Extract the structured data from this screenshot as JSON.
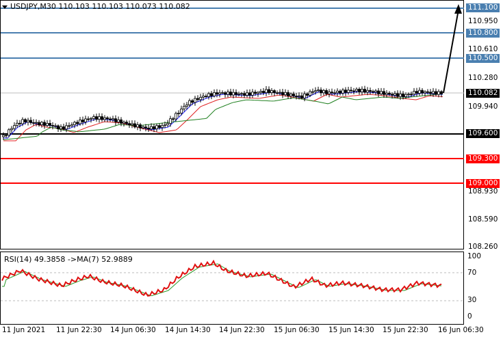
{
  "header": {
    "symbol_info": "USDJPY,M30  110.103 110.103 110.073 110.082",
    "rsi_info": "RSI(14) 49.3858  ->MA(7) 52.9889"
  },
  "colors": {
    "blue_line": "#4a7fb0",
    "black_line": "#000000",
    "red_line": "#ff0000",
    "ma_fast": "#1a1aff",
    "ma_mid": "#e02020",
    "ma_slow": "#208020",
    "rsi_line": "#e01010",
    "rsi_ma": "#2a9a2a"
  },
  "price_axis": [
    "110.950",
    "110.610",
    "110.280",
    "109.940",
    "108.930",
    "108.590",
    "108.260"
  ],
  "levels": [
    {
      "label": "111.100",
      "color": "#4a7fb0",
      "kind": "blue"
    },
    {
      "label": "110.800",
      "color": "#4a7fb0",
      "kind": "blue"
    },
    {
      "label": "110.500",
      "color": "#4a7fb0",
      "kind": "blue"
    },
    {
      "label": "110.082",
      "color": "#000000",
      "kind": "current"
    },
    {
      "label": "109.600",
      "color": "#000000",
      "kind": "black"
    },
    {
      "label": "109.300",
      "color": "#ff0000",
      "kind": "red"
    },
    {
      "label": "109.000",
      "color": "#ff0000",
      "kind": "red"
    }
  ],
  "rsi_axis": [
    "100",
    "70",
    "30",
    "0"
  ],
  "time_axis": [
    "11 Jun 2021",
    "11 Jun 22:30",
    "14 Jun 06:30",
    "14 Jun 14:30",
    "14 Jun 22:30",
    "15 Jun 06:30",
    "15 Jun 14:30",
    "15 Jun 22:30",
    "16 Jun 06:30"
  ]
}
